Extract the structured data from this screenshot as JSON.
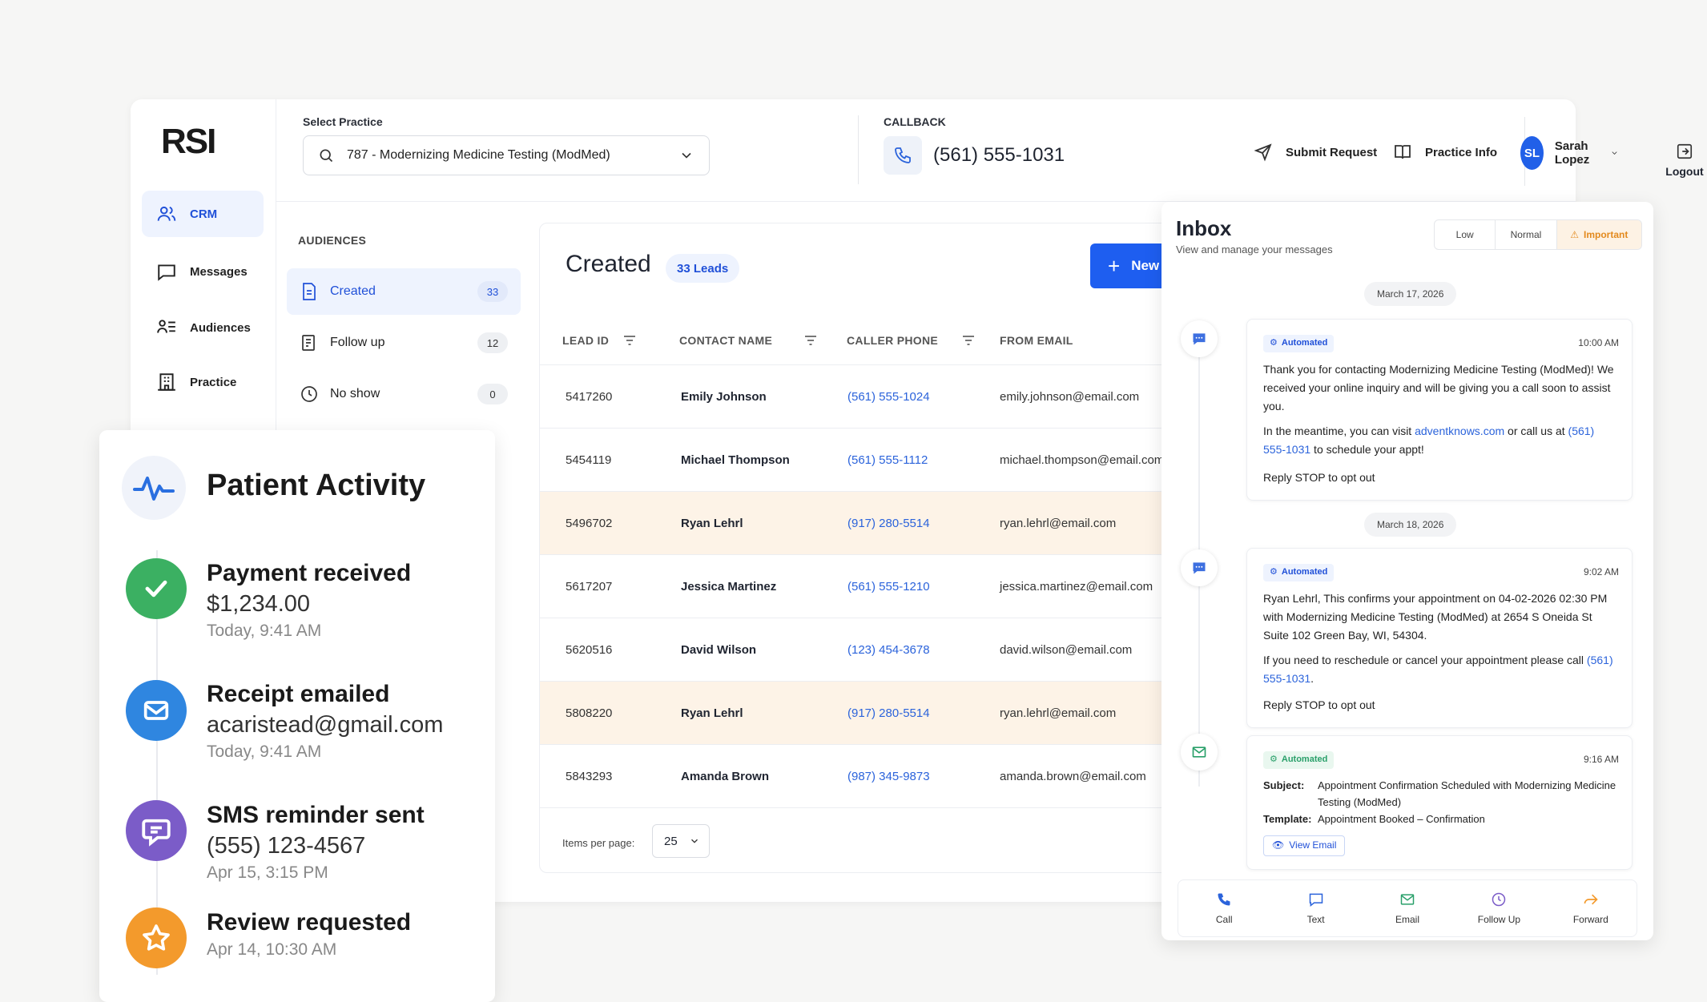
{
  "sidebar": {
    "logo": "RSI",
    "items": [
      {
        "label": "CRM",
        "icon": "users-icon",
        "active": true
      },
      {
        "label": "Messages",
        "icon": "message-square-icon"
      },
      {
        "label": "Audiences",
        "icon": "audience-list-icon"
      },
      {
        "label": "Practice",
        "icon": "building-icon"
      }
    ]
  },
  "header": {
    "select_practice_label": "Select Practice",
    "practice_value": "787 - Modernizing Medicine Testing (ModMed)",
    "callback_label": "CALLBACK",
    "callback_number": "(561) 555-1031",
    "submit_request": "Submit Request",
    "practice_info": "Practice Info",
    "user_initials": "SL",
    "user_name": "Sarah Lopez",
    "logout": "Logout"
  },
  "audiences": {
    "title": "AUDIENCES",
    "items": [
      {
        "label": "Created",
        "count": "33",
        "active": true
      },
      {
        "label": "Follow up",
        "count": "12"
      },
      {
        "label": "No show",
        "count": "0"
      }
    ]
  },
  "leads": {
    "title": "Created",
    "badge": "33 Leads",
    "new_button": "New",
    "columns": [
      "LEAD ID",
      "CONTACT NAME",
      "CALLER PHONE",
      "FROM EMAIL"
    ],
    "rows": [
      {
        "id": "5417260",
        "name": "Emily Johnson",
        "phone": "(561) 555-1024",
        "email": "emily.johnson@email.com"
      },
      {
        "id": "5454119",
        "name": "Michael Thompson",
        "phone": "(561) 555-1112",
        "email": "michael.thompson@email.com"
      },
      {
        "id": "5496702",
        "name": "Ryan Lehrl",
        "phone": "(917) 280-5514",
        "email": "ryan.lehrl@email.com"
      },
      {
        "id": "5617207",
        "name": "Jessica Martinez",
        "phone": "(561) 555-1210",
        "email": "jessica.martinez@email.com"
      },
      {
        "id": "5620516",
        "name": "David Wilson",
        "phone": "(123) 454-3678",
        "email": "david.wilson@email.com"
      },
      {
        "id": "5808220",
        "name": "Ryan Lehrl",
        "phone": "(917) 280-5514",
        "email": "ryan.lehrl@email.com"
      },
      {
        "id": "5843293",
        "name": "Amanda Brown",
        "phone": "(987) 345-9873",
        "email": "amanda.brown@email.com"
      }
    ],
    "items_per_page_label": "Items per page:",
    "items_per_page": "25"
  },
  "inbox": {
    "title": "Inbox",
    "subtitle": "View and manage your messages",
    "priority": [
      "Low",
      "Normal",
      "Important"
    ],
    "date1": "March 17, 2026",
    "date2": "March 18, 2026",
    "automated": "Automated",
    "msg1": {
      "time": "10:00 AM",
      "p1": "Thank you for contacting Modernizing Medicine Testing (ModMed)! We received your online inquiry and will be giving you a call soon to assist you.",
      "p2a": "In the meantime, you can visit ",
      "p2link": "adventknows.com",
      "p2b": " or call us at ",
      "p2phone": "(561) 555-1031",
      "p2c": " to schedule your appt!",
      "p3": "Reply STOP to opt out"
    },
    "msg2": {
      "time": "9:02 AM",
      "p1": "Ryan Lehrl, This confirms your appointment on 04-02-2026 02:30 PM with Modernizing Medicine Testing (ModMed) at 2654 S Oneida St Suite 102 Green Bay, WI, 54304.",
      "p2a": "If you need to reschedule or cancel your appointment please call ",
      "p2phone": "(561) 555-1031",
      "p2b": ".",
      "p3": "Reply STOP to opt out"
    },
    "msg3": {
      "time": "9:16 AM",
      "subject_label": "Subject:",
      "subject": "Appointment Confirmation Scheduled with Modernizing Medicine Testing (ModMed)",
      "template_label": "Template:",
      "template": "Appointment Booked – Confirmation",
      "view_email": "View Email"
    },
    "actions": [
      "Call",
      "Text",
      "Email",
      "Follow Up",
      "Forward"
    ]
  },
  "activity": {
    "title": "Patient Activity",
    "items": [
      {
        "heading": "Payment received",
        "value": "$1,234.00",
        "time": "Today, 9:41 AM",
        "color": "#3bb062"
      },
      {
        "heading": "Receipt emailed",
        "value": "acaristead@gmail.com",
        "time": "Today, 9:41 AM",
        "color": "#2f86e0"
      },
      {
        "heading": "SMS reminder sent",
        "value": "(555) 123-4567",
        "time": "Apr 15, 3:15 PM",
        "color": "#7b5cc8"
      },
      {
        "heading": "Review requested",
        "value": "",
        "time": "Apr 14, 10:30 AM",
        "color": "#f39a2c"
      }
    ]
  },
  "colors": {
    "accent": "#1e5ef0",
    "highlight_row": "#fdf3e7",
    "important": "#e38a1e"
  }
}
